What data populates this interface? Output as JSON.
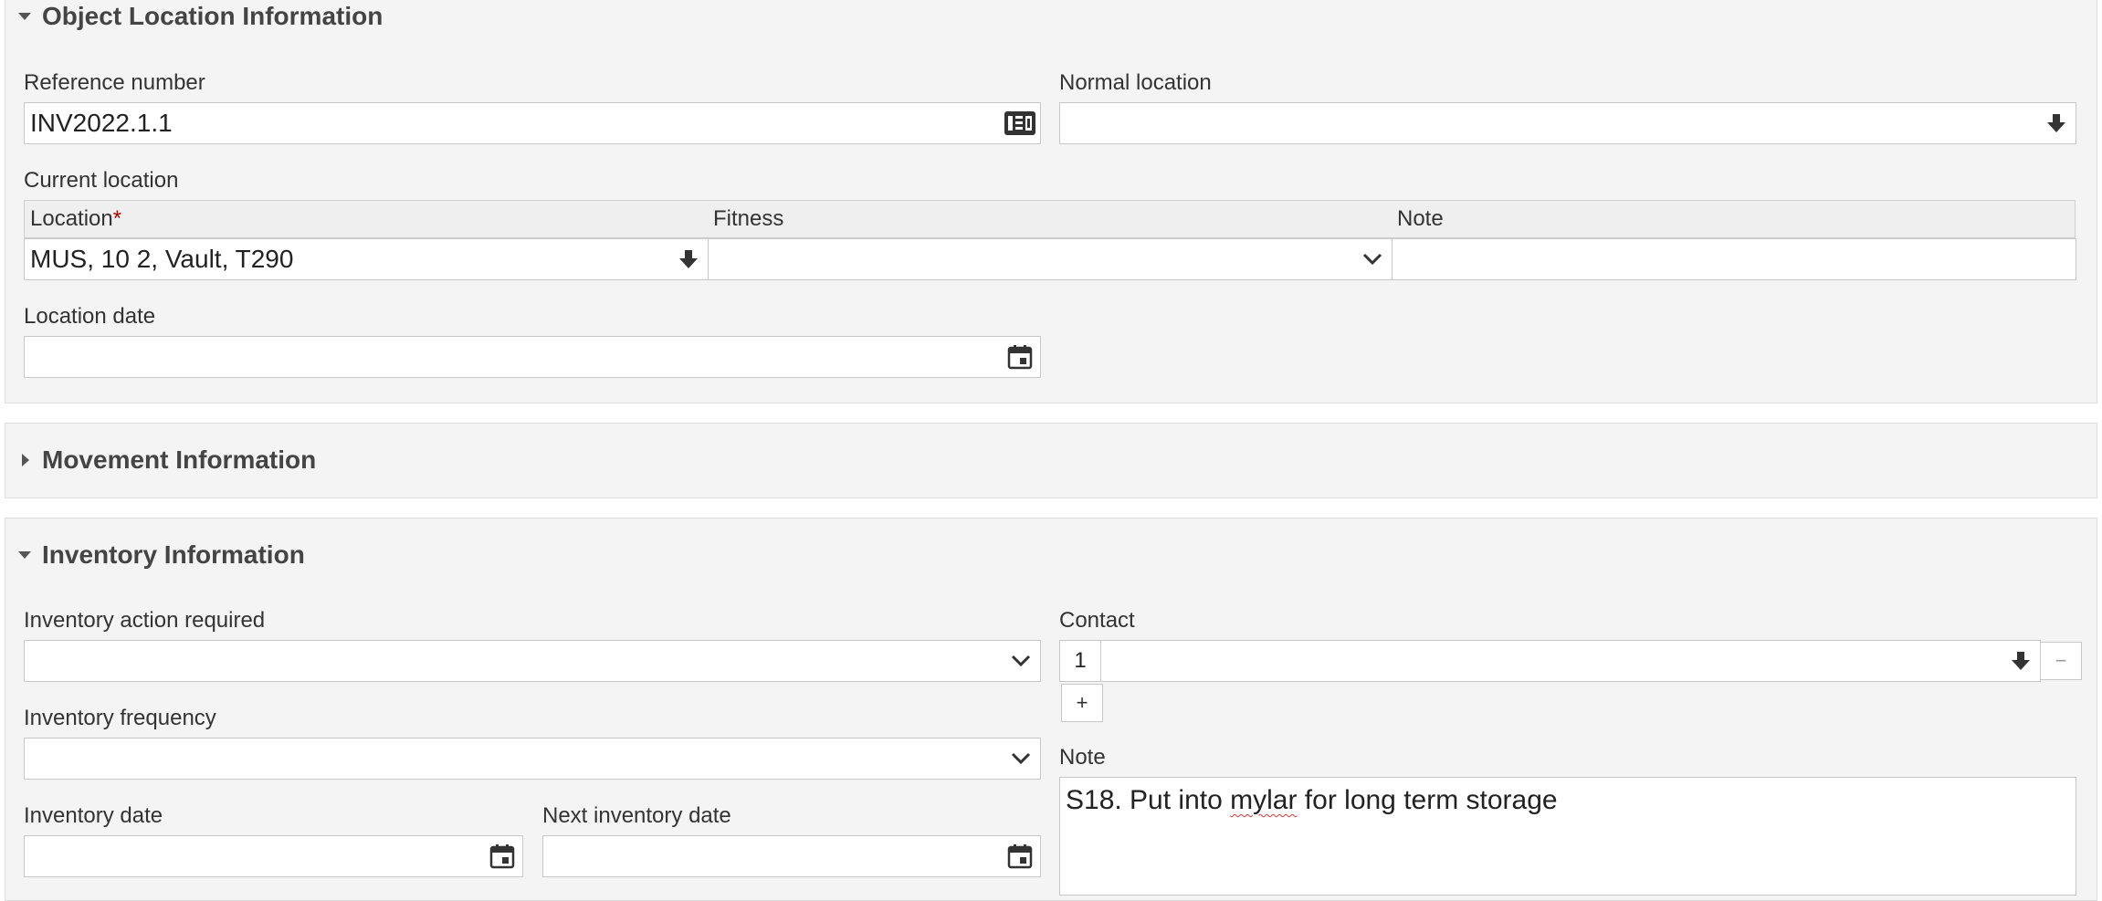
{
  "object_location": {
    "title": "Object Location Information",
    "reference_number": {
      "label": "Reference number",
      "value": "INV2022.1.1"
    },
    "normal_location": {
      "label": "Normal location",
      "value": ""
    },
    "current_location": {
      "label": "Current location",
      "columns": {
        "location": "Location",
        "required_mark": "*",
        "fitness": "Fitness",
        "note": "Note"
      },
      "row": {
        "location": "MUS, 10 2, Vault, T290",
        "fitness": "",
        "note": ""
      }
    },
    "location_date": {
      "label": "Location date",
      "value": ""
    }
  },
  "movement": {
    "title": "Movement Information"
  },
  "inventory": {
    "title": "Inventory Information",
    "action_required": {
      "label": "Inventory action required",
      "value": ""
    },
    "frequency": {
      "label": "Inventory frequency",
      "value": ""
    },
    "inventory_date": {
      "label": "Inventory date",
      "value": ""
    },
    "next_inventory_date": {
      "label": "Next inventory date",
      "value": ""
    },
    "contact": {
      "label": "Contact",
      "index": "1",
      "value": "",
      "add": "+",
      "remove": "−"
    },
    "note": {
      "label": "Note",
      "value_prefix": "S18. Put into ",
      "value_misspelled": "mylar",
      "value_suffix": " for long term storage"
    }
  },
  "icons": {
    "reference": "number-generator-icon",
    "autocomplete": "download-arrow-icon",
    "dropdown": "chevron-down-icon",
    "calendar": "calendar-icon",
    "expand": "triangle-right-icon",
    "collapse": "triangle-down-icon"
  }
}
